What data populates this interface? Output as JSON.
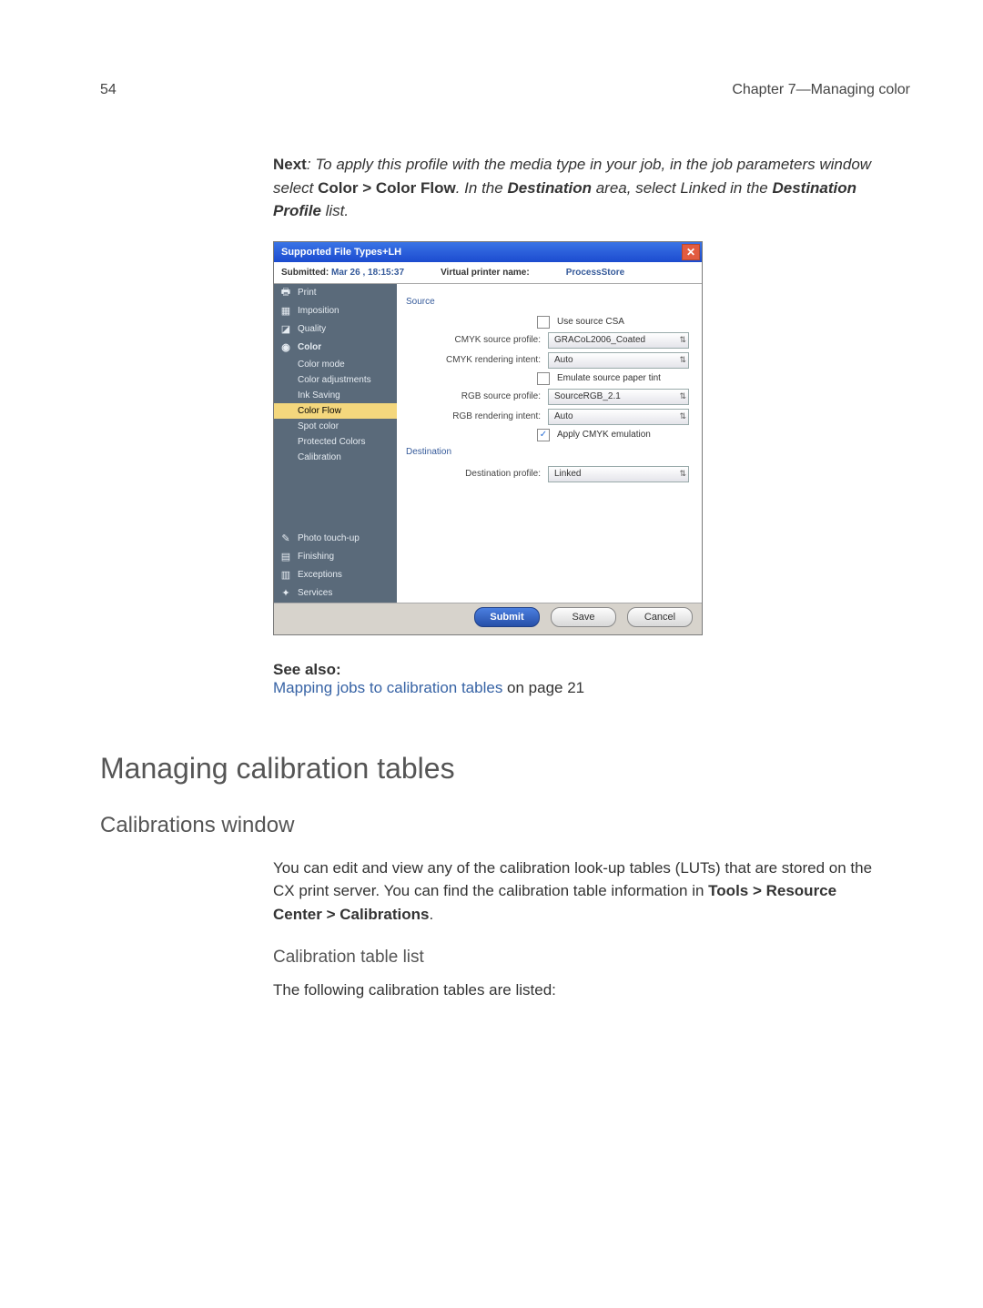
{
  "page_number": "54",
  "chapter_label": "Chapter 7—Managing color",
  "next_block": {
    "label": "Next",
    "sep": ": ",
    "p1a": "To apply this profile with the media type in your job, in the job parameters window select ",
    "path": "Color > Color Flow",
    "p1b": ". In the ",
    "dest": "Destination",
    "p1c": " area, select Linked in the ",
    "dpl": "Destination Profile",
    "p1d": " list."
  },
  "shot": {
    "title": "Supported File Types+LH",
    "submitted_k": "Submitted:",
    "submitted_v": "Mar 26 , 18:15:37",
    "vpn_k": "Virtual printer name:",
    "vpn_v": "ProcessStore",
    "cats_top": [
      {
        "label": "Print",
        "icon": "🖶"
      },
      {
        "label": "Imposition",
        "icon": "▦"
      },
      {
        "label": "Quality",
        "icon": "◪"
      },
      {
        "label": "Color",
        "icon": "◉",
        "expanded": true
      }
    ],
    "color_subs": [
      "Color mode",
      "Color adjustments",
      "Ink Saving",
      "Color Flow",
      "Spot color",
      "Protected Colors",
      "Calibration"
    ],
    "color_selected": "Color Flow",
    "cats_bottom": [
      {
        "label": "Photo touch-up",
        "icon": "✎"
      },
      {
        "label": "Finishing",
        "icon": "▤"
      },
      {
        "label": "Exceptions",
        "icon": "▥"
      },
      {
        "label": "Services",
        "icon": "✦"
      }
    ],
    "section_source": "Source",
    "use_source_csa": "Use source CSA",
    "cmyk_src_k": "CMYK source profile:",
    "cmyk_src_v": "GRACoL2006_Coated",
    "cmyk_ri_k": "CMYK rendering intent:",
    "cmyk_ri_v": "Auto",
    "emulate": "Emulate source paper tint",
    "rgb_src_k": "RGB source profile:",
    "rgb_src_v": "SourceRGB_2.1",
    "rgb_ri_k": "RGB rendering intent:",
    "rgb_ri_v": "Auto",
    "apply_cmyk": "Apply CMYK emulation",
    "apply_cmyk_checked": "✓",
    "section_dest": "Destination",
    "dest_k": "Destination profile:",
    "dest_v": "Linked",
    "buttons": {
      "submit": "Submit",
      "save": "Save",
      "cancel": "Cancel"
    }
  },
  "see_also": {
    "hdr": "See also:",
    "link": "Mapping jobs to calibration tables",
    "tail": " on page 21"
  },
  "h1": "Managing calibration tables",
  "h2": "Calibrations window",
  "calib_para_a": "You can edit and view any of the calibration look-up tables (LUTs) that are stored on the CX print server. You can find the calibration table information in ",
  "calib_para_b": "Tools > Resource Center > Calibrations",
  "calib_para_c": ".",
  "h3": "Calibration table list",
  "list_intro": "The following calibration tables are listed:"
}
